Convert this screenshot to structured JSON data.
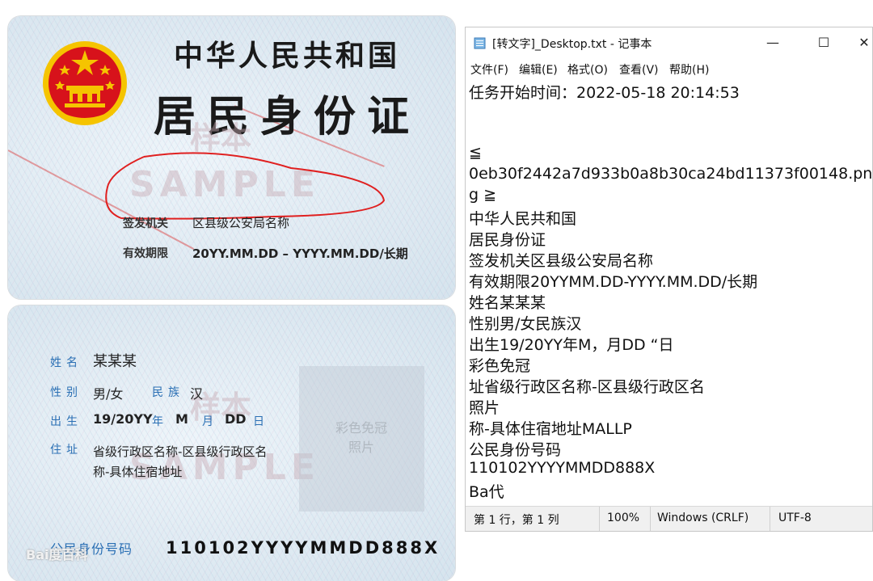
{
  "id_front": {
    "title1": "中华人民共和国",
    "title2": "居民身份证",
    "watermark_cn": "样本",
    "watermark_en": "SAMPLE",
    "issuer_label": "签发机关",
    "issuer_value": "区县级公安局名称",
    "validity_label": "有效期限",
    "validity_value": "20YY.MM.DD – YYYY.MM.DD/长期"
  },
  "id_back": {
    "name_label": "姓名",
    "name_value": "某某某",
    "gender_label": "性别",
    "gender_value": "男/女",
    "ethnicity_label": "民族",
    "ethnicity_value": "汉",
    "birth_label": "出生",
    "birth_year": "19/20YY",
    "year_char": "年",
    "birth_month": "M",
    "month_char": "月",
    "birth_day": "DD",
    "day_char": "日",
    "address_label": "住址",
    "address_line1": "省级行政区名称-区县级行政区名",
    "address_line2": "称-具体住宿地址",
    "photo_line1": "彩色免冠",
    "photo_line2": "照片",
    "id_label": "公民身份号码",
    "id_value": "110102YYYYMMDD888X",
    "watermark_cn": "样本",
    "watermark_en": "SAMPLE",
    "source_mark": "Bai度百科"
  },
  "notepad": {
    "title": "[转文字]_Desktop.txt - 记事本",
    "menu": [
      "文件(F)",
      "编辑(E)",
      "格式(O)",
      "查看(V)",
      "帮助(H)"
    ],
    "lines": [
      "任务开始时间：2022-05-18 20:14:53",
      "",
      "",
      "≦",
      "0eb30f2442a7d933b0a8b30ca24bd11373f00148.pn",
      "g ≧",
      "中华人民共和国",
      "居民身份证",
      "签发机关区县级公安局名称",
      "有效期限20YYMM.DD-YYYY.MM.DD/长期",
      "姓名某某某",
      "性别男/女民族汉",
      "出生19/20YY年M，月DD “日",
      "彩色免冠",
      "址省级行政区名称-区县级行政区名",
      "照片",
      "称-具体住宿地址MALLP",
      "公民身份号码",
      "110102YYYYMMDD888X",
      "Ba代"
    ],
    "status": {
      "position": "第 1 行，第 1 列",
      "zoom": "100%",
      "line_ending": "Windows (CRLF)",
      "encoding": "UTF-8"
    },
    "icons": {
      "minimize": "minimize-icon",
      "maximize": "maximize-icon",
      "close": "close-icon"
    }
  },
  "colors": {
    "annotation_red": "#e02020",
    "label_blue": "#2a6fb4",
    "emblem_red": "#d7121b",
    "emblem_gold": "#f5c400"
  }
}
